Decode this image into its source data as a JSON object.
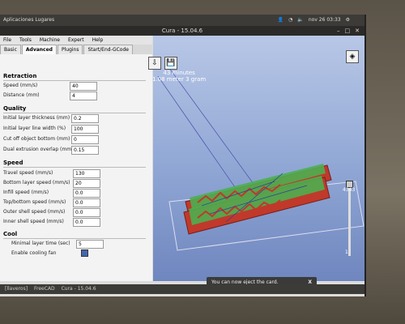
{
  "system": {
    "top_left": "Aplicaciones  Lugares",
    "clock": "nov 26 03:33"
  },
  "window": {
    "title": "Cura - 15.04.6"
  },
  "menu": [
    "File",
    "Tools",
    "Machine",
    "Expert",
    "Help"
  ],
  "tabs": [
    "Basic",
    "Advanced",
    "Plugins",
    "Start/End-GCode"
  ],
  "sections": {
    "retraction": "Retraction",
    "quality": "Quality",
    "speed": "Speed",
    "cool": "Cool"
  },
  "fields": {
    "speed_label": "Speed (mm/s)",
    "speed_value": "40",
    "distance_label": "Distance (mm)",
    "distance_value": "4",
    "initial_layer_thickness_label": "Initial layer thickness (mm)",
    "initial_layer_thickness_value": "0.2",
    "initial_layer_line_width_label": "Initial layer line width (%)",
    "initial_layer_line_width_value": "100",
    "cut_off_bottom_label": "Cut off object bottom (mm)",
    "cut_off_bottom_value": "0",
    "dual_extrusion_overlap_label": "Dual extrusion overlap (mm)",
    "dual_extrusion_overlap_value": "0.15",
    "travel_speed_label": "Travel speed (mm/s)",
    "travel_speed_value": "130",
    "bottom_layer_speed_label": "Bottom layer speed (mm/s)",
    "bottom_layer_speed_value": "20",
    "infill_speed_label": "Infill speed (mm/s)",
    "infill_speed_value": "0.0",
    "top_bottom_speed_label": "Top/bottom speed (mm/s)",
    "top_bottom_speed_value": "0.0",
    "outer_shell_speed_label": "Outer shell speed (mm/s)",
    "outer_shell_speed_value": "0.0",
    "inner_shell_speed_label": "Inner shell speed (mm/s)",
    "inner_shell_speed_value": "0.0",
    "minimal_layer_time_label": "Minimal layer time (sec)",
    "minimal_layer_time_value": "5",
    "enable_cooling_fan_label": "Enable cooling fan"
  },
  "print_info": {
    "time": "43 minutes",
    "material": "1.08 meter 3 gram"
  },
  "layer": {
    "current": "43",
    "total": "43",
    "min": "1"
  },
  "notice": {
    "text": "You can now eject the card.",
    "close": "X"
  },
  "taskbar": [
    "[llaveros]",
    "FreeCAD",
    "Cura - 15.04.6"
  ]
}
